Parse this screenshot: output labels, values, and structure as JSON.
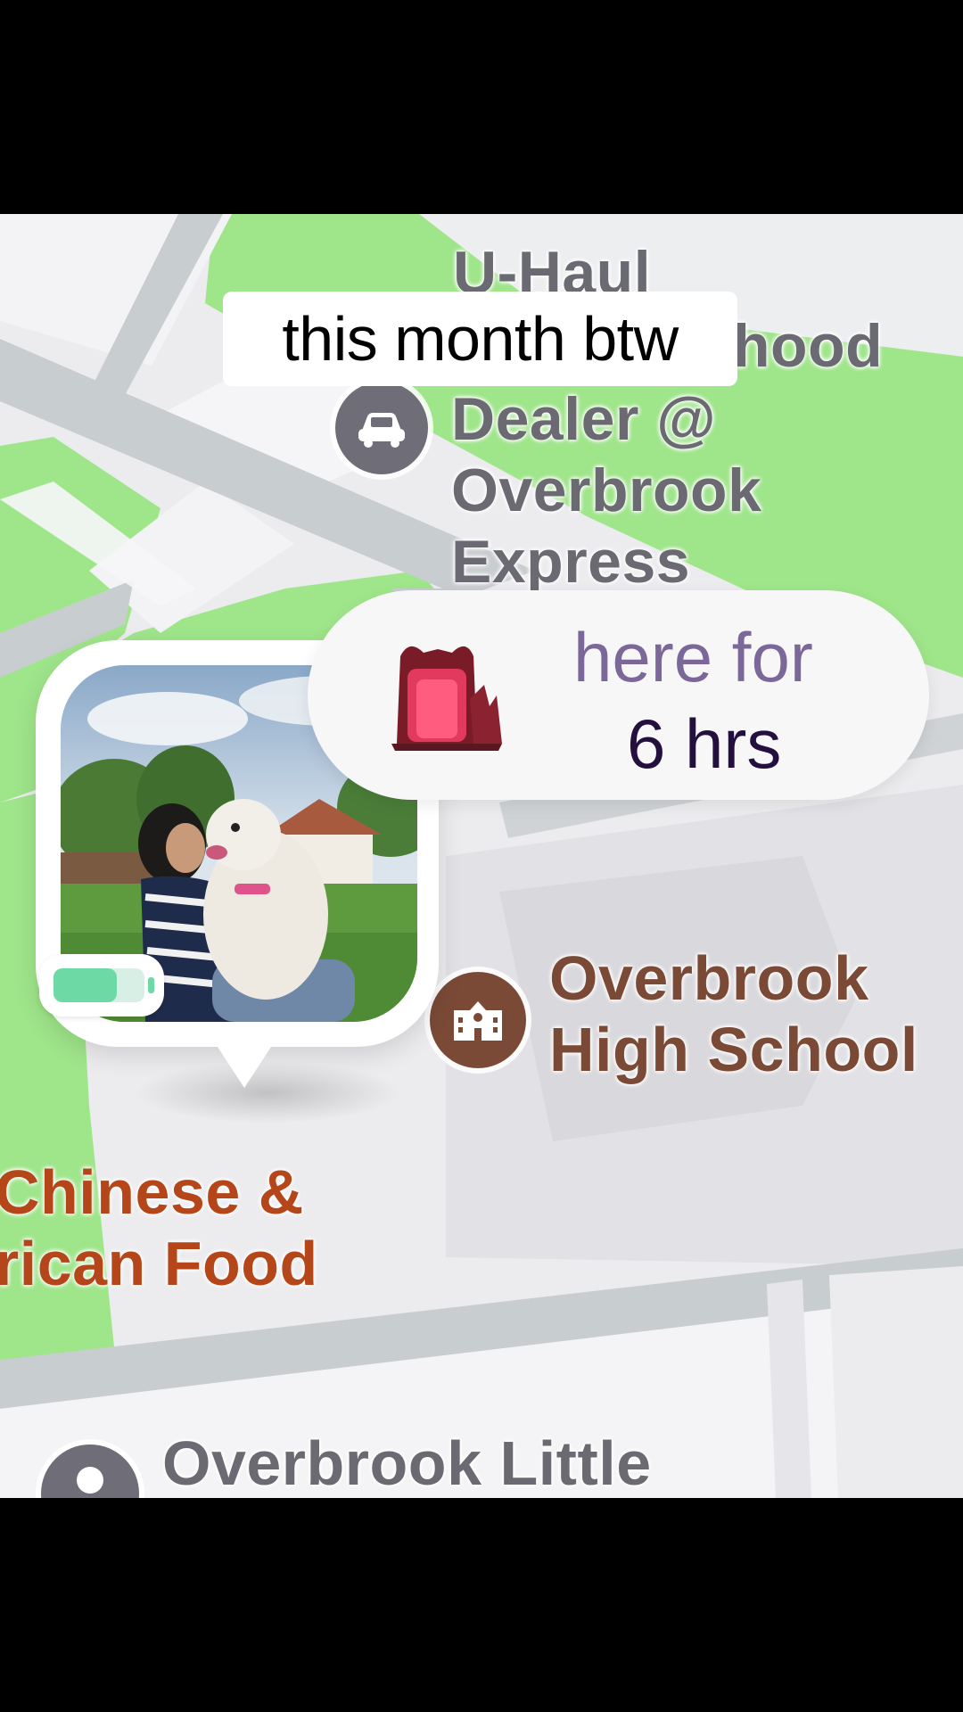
{
  "caption": {
    "text": "this month btw"
  },
  "map": {
    "labels": {
      "uhaul_line1": "U-Haul",
      "uhaul_line2": "hood",
      "dealer_line1": "Dealer @",
      "dealer_line2": "Overbrook",
      "dealer_line3": "Express",
      "school_line1": "Overbrook",
      "school_line2": "High School",
      "food_line1": "Chinese &",
      "food_line2": "rican Food",
      "little_line1": "Overbrook Little"
    },
    "colors": {
      "land": "#e9e8ec",
      "park": "#9fe58a",
      "road": "#c9ced0",
      "poi_gray": "#6e6d78",
      "poi_brown": "#7a4a36"
    }
  },
  "status_pill": {
    "line1": "here for",
    "line2": "6 hrs",
    "icon": "red-portal-icon"
  },
  "friend_marker": {
    "icon": "avatar-photo",
    "battery_level": 0.7,
    "battery_color": "#6dd9a5"
  }
}
